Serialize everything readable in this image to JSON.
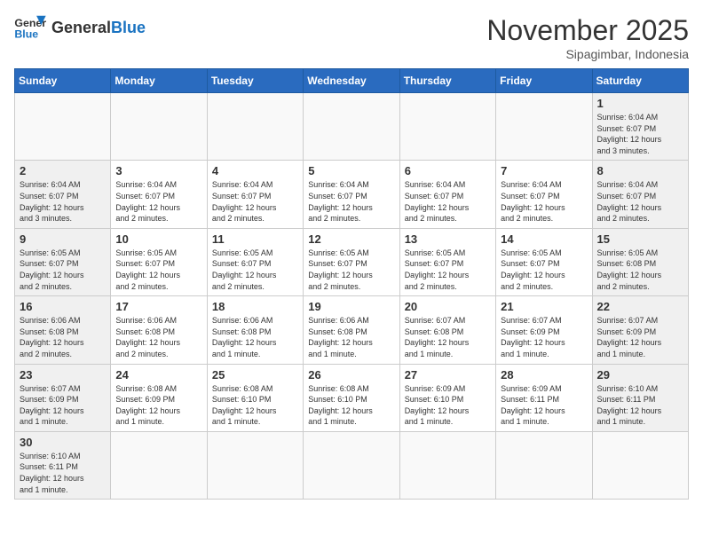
{
  "header": {
    "logo_general": "General",
    "logo_blue": "Blue",
    "month_year": "November 2025",
    "location": "Sipagimbar, Indonesia"
  },
  "weekdays": [
    "Sunday",
    "Monday",
    "Tuesday",
    "Wednesday",
    "Thursday",
    "Friday",
    "Saturday"
  ],
  "weeks": [
    [
      {
        "day": "",
        "info": "",
        "empty": true
      },
      {
        "day": "",
        "info": "",
        "empty": true
      },
      {
        "day": "",
        "info": "",
        "empty": true
      },
      {
        "day": "",
        "info": "",
        "empty": true
      },
      {
        "day": "",
        "info": "",
        "empty": true
      },
      {
        "day": "",
        "info": "",
        "empty": true
      },
      {
        "day": "1",
        "info": "Sunrise: 6:04 AM\nSunset: 6:07 PM\nDaylight: 12 hours\nand 3 minutes."
      }
    ],
    [
      {
        "day": "2",
        "info": "Sunrise: 6:04 AM\nSunset: 6:07 PM\nDaylight: 12 hours\nand 3 minutes."
      },
      {
        "day": "3",
        "info": "Sunrise: 6:04 AM\nSunset: 6:07 PM\nDaylight: 12 hours\nand 2 minutes."
      },
      {
        "day": "4",
        "info": "Sunrise: 6:04 AM\nSunset: 6:07 PM\nDaylight: 12 hours\nand 2 minutes."
      },
      {
        "day": "5",
        "info": "Sunrise: 6:04 AM\nSunset: 6:07 PM\nDaylight: 12 hours\nand 2 minutes."
      },
      {
        "day": "6",
        "info": "Sunrise: 6:04 AM\nSunset: 6:07 PM\nDaylight: 12 hours\nand 2 minutes."
      },
      {
        "day": "7",
        "info": "Sunrise: 6:04 AM\nSunset: 6:07 PM\nDaylight: 12 hours\nand 2 minutes."
      },
      {
        "day": "8",
        "info": "Sunrise: 6:04 AM\nSunset: 6:07 PM\nDaylight: 12 hours\nand 2 minutes."
      }
    ],
    [
      {
        "day": "9",
        "info": "Sunrise: 6:05 AM\nSunset: 6:07 PM\nDaylight: 12 hours\nand 2 minutes."
      },
      {
        "day": "10",
        "info": "Sunrise: 6:05 AM\nSunset: 6:07 PM\nDaylight: 12 hours\nand 2 minutes."
      },
      {
        "day": "11",
        "info": "Sunrise: 6:05 AM\nSunset: 6:07 PM\nDaylight: 12 hours\nand 2 minutes."
      },
      {
        "day": "12",
        "info": "Sunrise: 6:05 AM\nSunset: 6:07 PM\nDaylight: 12 hours\nand 2 minutes."
      },
      {
        "day": "13",
        "info": "Sunrise: 6:05 AM\nSunset: 6:07 PM\nDaylight: 12 hours\nand 2 minutes."
      },
      {
        "day": "14",
        "info": "Sunrise: 6:05 AM\nSunset: 6:07 PM\nDaylight: 12 hours\nand 2 minutes."
      },
      {
        "day": "15",
        "info": "Sunrise: 6:05 AM\nSunset: 6:08 PM\nDaylight: 12 hours\nand 2 minutes."
      }
    ],
    [
      {
        "day": "16",
        "info": "Sunrise: 6:06 AM\nSunset: 6:08 PM\nDaylight: 12 hours\nand 2 minutes."
      },
      {
        "day": "17",
        "info": "Sunrise: 6:06 AM\nSunset: 6:08 PM\nDaylight: 12 hours\nand 2 minutes."
      },
      {
        "day": "18",
        "info": "Sunrise: 6:06 AM\nSunset: 6:08 PM\nDaylight: 12 hours\nand 1 minute."
      },
      {
        "day": "19",
        "info": "Sunrise: 6:06 AM\nSunset: 6:08 PM\nDaylight: 12 hours\nand 1 minute."
      },
      {
        "day": "20",
        "info": "Sunrise: 6:07 AM\nSunset: 6:08 PM\nDaylight: 12 hours\nand 1 minute."
      },
      {
        "day": "21",
        "info": "Sunrise: 6:07 AM\nSunset: 6:09 PM\nDaylight: 12 hours\nand 1 minute."
      },
      {
        "day": "22",
        "info": "Sunrise: 6:07 AM\nSunset: 6:09 PM\nDaylight: 12 hours\nand 1 minute."
      }
    ],
    [
      {
        "day": "23",
        "info": "Sunrise: 6:07 AM\nSunset: 6:09 PM\nDaylight: 12 hours\nand 1 minute."
      },
      {
        "day": "24",
        "info": "Sunrise: 6:08 AM\nSunset: 6:09 PM\nDaylight: 12 hours\nand 1 minute."
      },
      {
        "day": "25",
        "info": "Sunrise: 6:08 AM\nSunset: 6:10 PM\nDaylight: 12 hours\nand 1 minute."
      },
      {
        "day": "26",
        "info": "Sunrise: 6:08 AM\nSunset: 6:10 PM\nDaylight: 12 hours\nand 1 minute."
      },
      {
        "day": "27",
        "info": "Sunrise: 6:09 AM\nSunset: 6:10 PM\nDaylight: 12 hours\nand 1 minute."
      },
      {
        "day": "28",
        "info": "Sunrise: 6:09 AM\nSunset: 6:11 PM\nDaylight: 12 hours\nand 1 minute."
      },
      {
        "day": "29",
        "info": "Sunrise: 6:10 AM\nSunset: 6:11 PM\nDaylight: 12 hours\nand 1 minute."
      }
    ],
    [
      {
        "day": "30",
        "info": "Sunrise: 6:10 AM\nSunset: 6:11 PM\nDaylight: 12 hours\nand 1 minute."
      },
      {
        "day": "",
        "info": "",
        "empty": true
      },
      {
        "day": "",
        "info": "",
        "empty": true
      },
      {
        "day": "",
        "info": "",
        "empty": true
      },
      {
        "day": "",
        "info": "",
        "empty": true
      },
      {
        "day": "",
        "info": "",
        "empty": true
      },
      {
        "day": "",
        "info": "",
        "empty": true
      }
    ]
  ]
}
